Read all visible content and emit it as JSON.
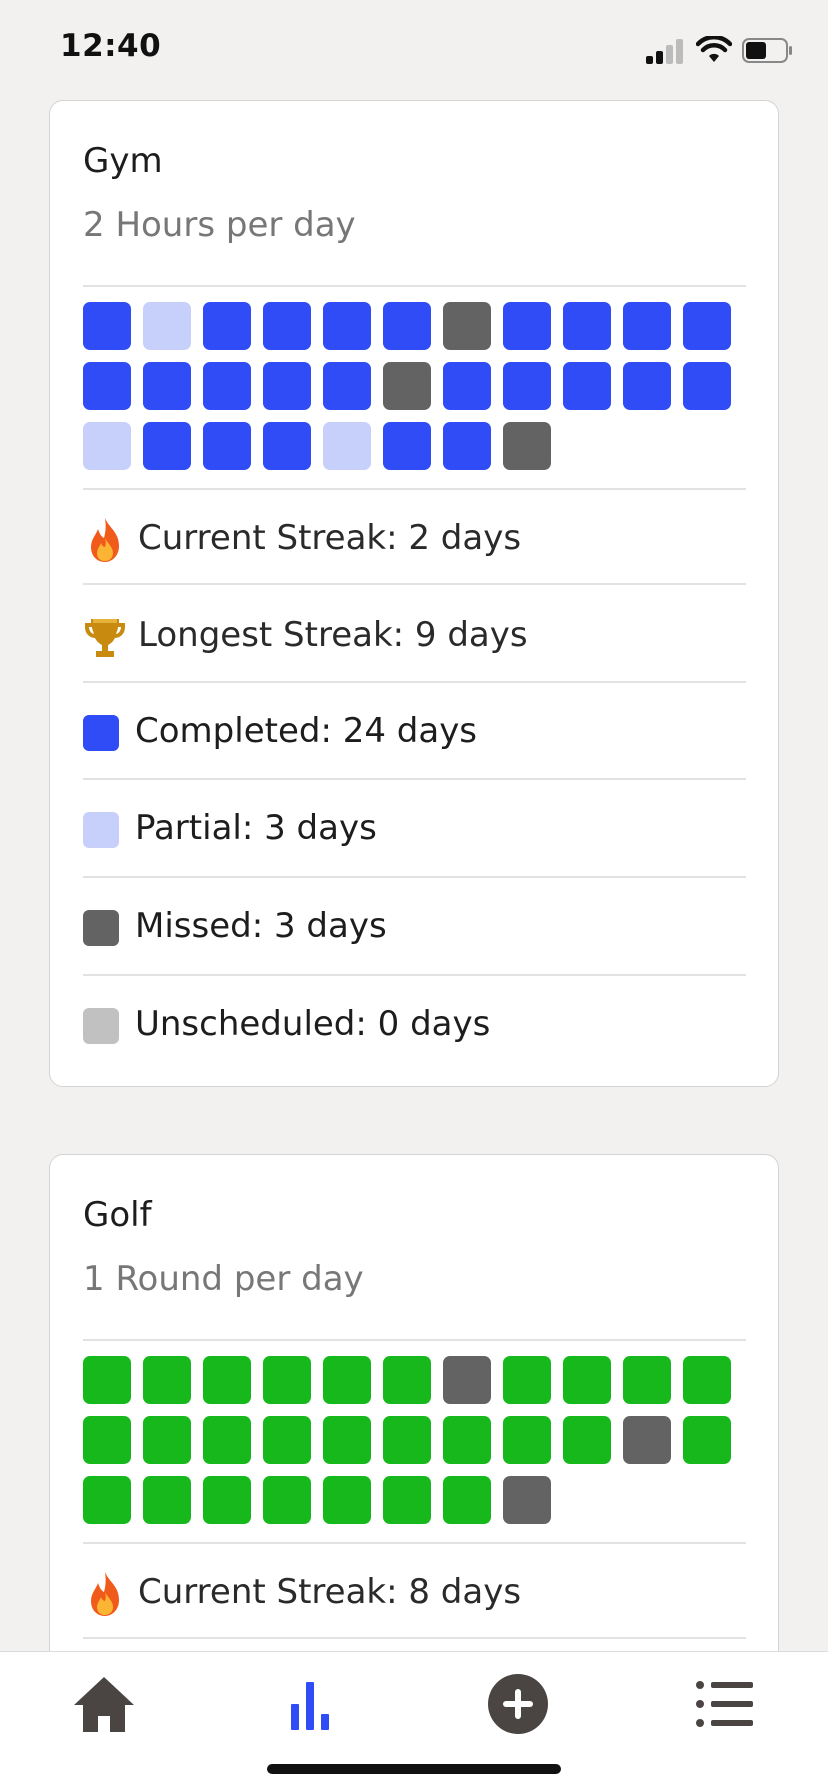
{
  "status_bar": {
    "time": "12:40"
  },
  "colors": {
    "completed_gym": "#2f4cf7",
    "partial_gym": "#c7d0fb",
    "missed": "#636363",
    "unscheduled": "#c1c1c1",
    "completed_golf": "#16b81c",
    "tab_active": "#2f4cf7",
    "tab_inactive": "#4a4442"
  },
  "habits": [
    {
      "title": "Gym",
      "goal": "2 Hours per day",
      "calendar": [
        "c",
        "p",
        "c",
        "c",
        "c",
        "c",
        "m",
        "c",
        "c",
        "c",
        "c",
        "c",
        "c",
        "c",
        "c",
        "c",
        "m",
        "c",
        "c",
        "c",
        "c",
        "c",
        "p",
        "c",
        "c",
        "c",
        "p",
        "c",
        "c",
        "m"
      ],
      "stats": {
        "current_streak": "Current Streak: 2 days",
        "longest_streak": "Longest Streak: 9 days",
        "completed": "Completed: 24 days",
        "partial": "Partial: 3 days",
        "missed": "Missed: 3 days",
        "unscheduled": "Unscheduled: 0 days"
      }
    },
    {
      "title": "Golf",
      "goal": "1 Round per day",
      "calendar": [
        "c",
        "c",
        "c",
        "c",
        "c",
        "c",
        "m",
        "c",
        "c",
        "c",
        "c",
        "c",
        "c",
        "c",
        "c",
        "c",
        "c",
        "c",
        "c",
        "c",
        "m",
        "c",
        "c",
        "c",
        "c",
        "c",
        "c",
        "c",
        "c",
        "m"
      ],
      "stats": {
        "current_streak": "Current Streak: 8 days"
      }
    }
  ],
  "tabbar": {
    "tabs": [
      {
        "name": "home",
        "icon": "home-icon",
        "active": false
      },
      {
        "name": "stats",
        "icon": "bar-chart-icon",
        "active": true
      },
      {
        "name": "add",
        "icon": "plus-circle-icon",
        "active": false
      },
      {
        "name": "list",
        "icon": "list-icon",
        "active": false
      }
    ]
  }
}
